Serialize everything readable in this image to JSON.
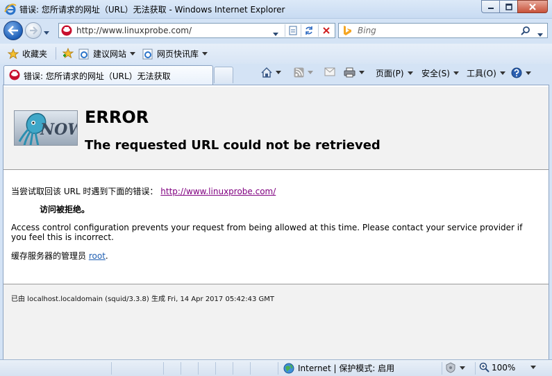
{
  "window": {
    "title": "错误: 您所请求的网址（URL）无法获取 - Windows Internet Explorer"
  },
  "address_bar": {
    "url": "http://www.linuxprobe.com/"
  },
  "search": {
    "placeholder": "Bing"
  },
  "favorites_bar": {
    "favorites_label": "收藏夹",
    "items": [
      {
        "label": "建议网站"
      },
      {
        "label": "网页快讯库"
      }
    ]
  },
  "tab": {
    "label": "错误: 您所请求的网址（URL）无法获取"
  },
  "command_bar": {
    "page_label": "页面(P)",
    "safety_label": "安全(S)",
    "tools_label": "工具(O)"
  },
  "page": {
    "logo_text": "NOW",
    "error_heading": "ERROR",
    "error_subheading": "The requested URL could not be retrieved",
    "attempt_prefix": "当尝试取回该 URL 时遇到下面的错误：",
    "attempt_url": "http://www.linuxprobe.com/",
    "denied_text": "访问被拒绝。",
    "policy_text": "Access control configuration prevents your request from being allowed at this time. Please contact your service provider if you feel this is incorrect.",
    "admin_prefix": "缓存服务器的管理员",
    "admin_link": "root",
    "admin_suffix": ".",
    "generated_text": "已由 localhost.localdomain (squid/3.3.8) 生成 Fri, 14 Apr 2017 05:42:43 GMT"
  },
  "status_bar": {
    "zone_text": "Internet | 保护模式: 启用",
    "zoom_text": "100%"
  },
  "colors": {
    "visited_link": "#800080",
    "link": "#1f5fb3",
    "header_band": "#f2f2f2",
    "frame_blue": "#d4e3f5"
  }
}
